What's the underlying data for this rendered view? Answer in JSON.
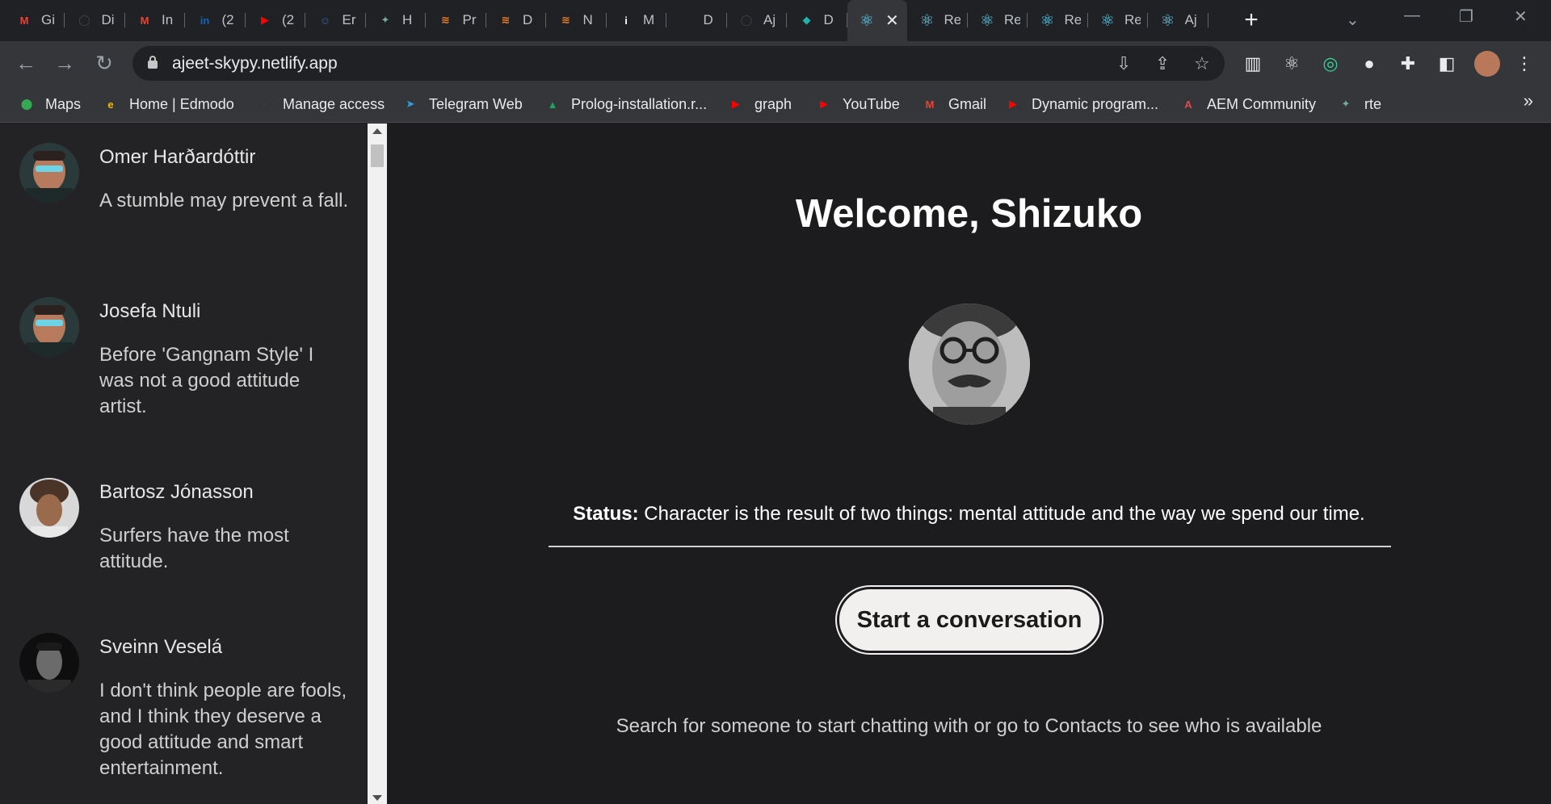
{
  "browser": {
    "tabs": [
      {
        "title": "Gi",
        "icon": "gmail-icon",
        "color": "#ea4335",
        "glyph": "M"
      },
      {
        "title": "Di",
        "icon": "github-icon",
        "color": "#444",
        "glyph": "◯"
      },
      {
        "title": "In",
        "icon": "gmail-icon",
        "color": "#ea4335",
        "glyph": "M"
      },
      {
        "title": "(2",
        "icon": "linkedin-icon",
        "color": "#0a66c2",
        "glyph": "in"
      },
      {
        "title": "(2",
        "icon": "youtube-icon",
        "color": "#ff0000",
        "glyph": "▶"
      },
      {
        "title": "Er",
        "icon": "person-icon",
        "color": "#2a6db5",
        "glyph": "☺"
      },
      {
        "title": "H",
        "icon": "chatgpt-icon",
        "color": "#74aa9c",
        "glyph": "✦"
      },
      {
        "title": "Pr",
        "icon": "stack-icon",
        "color": "#f48024",
        "glyph": "≋"
      },
      {
        "title": "D",
        "icon": "stack-icon",
        "color": "#f48024",
        "glyph": "≋"
      },
      {
        "title": "N",
        "icon": "stack-icon",
        "color": "#f48024",
        "glyph": "≋"
      },
      {
        "title": "M",
        "icon": "info-icon",
        "color": "#ffffff",
        "glyph": "i"
      },
      {
        "title": "D",
        "icon": "download-icon",
        "color": "#202124",
        "glyph": "⬇"
      },
      {
        "title": "Aj",
        "icon": "github-icon",
        "color": "#444",
        "glyph": "◯"
      },
      {
        "title": "D",
        "icon": "diamond-icon",
        "color": "#20b2aa",
        "glyph": "◆"
      }
    ],
    "active_tab": {
      "icon": "react-icon",
      "close": "✕"
    },
    "trailing_tabs": [
      {
        "title": "Re",
        "icon": "react-icon"
      },
      {
        "title": "Re",
        "icon": "react-icon"
      },
      {
        "title": "Re",
        "icon": "react-icon"
      },
      {
        "title": "Re",
        "icon": "react-icon"
      },
      {
        "title": "Aj",
        "icon": "react-icon"
      }
    ],
    "url": "ajeet-skypy.netlify.app",
    "bookmarks": [
      {
        "label": "Maps",
        "icon": "maps-icon",
        "color": "#34a853",
        "glyph": "⬤"
      },
      {
        "label": "Home | Edmodo",
        "icon": "edmodo-icon",
        "color": "#f5b800",
        "glyph": "e"
      },
      {
        "label": "Manage access",
        "icon": "github-icon",
        "color": "#333",
        "glyph": "◯"
      },
      {
        "label": "Telegram Web",
        "icon": "telegram-icon",
        "color": "#2aa3e0",
        "glyph": "➤"
      },
      {
        "label": "Prolog-installation.r...",
        "icon": "drive-icon",
        "color": "#1fa463",
        "glyph": "▲"
      },
      {
        "label": "graph",
        "icon": "youtube-icon",
        "color": "#ff0000",
        "glyph": "▶"
      },
      {
        "label": "YouTube",
        "icon": "youtube-icon",
        "color": "#ff0000",
        "glyph": "▶"
      },
      {
        "label": "Gmail",
        "icon": "gmail-icon",
        "color": "#ea4335",
        "glyph": "M"
      },
      {
        "label": "Dynamic program...",
        "icon": "youtube-icon",
        "color": "#ff0000",
        "glyph": "▶"
      },
      {
        "label": "AEM Community",
        "icon": "adobe-icon",
        "color": "#e34850",
        "glyph": "A"
      },
      {
        "label": "rte",
        "icon": "chatgpt-icon",
        "color": "#74aa9c",
        "glyph": "✦"
      }
    ],
    "more": "»"
  },
  "contacts": [
    {
      "name": "Omer Harðardóttir",
      "message": "A stumble may prevent a fall."
    },
    {
      "name": "Josefa Ntuli",
      "message": "Before 'Gangnam Style' I was not a good attitude artist."
    },
    {
      "name": "Bartosz Jónasson",
      "message": "Surfers have the most attitude."
    },
    {
      "name": "Sveinn Veselá",
      "message": "I don't think people are fools, and I think they deserve a good attitude and smart entertainment."
    }
  ],
  "main": {
    "welcome": "Welcome, Shizuko",
    "status_label": "Status:",
    "status_text": " Character is the result of two things: mental attitude and the way we spend our time.",
    "start_button": "Start a conversation",
    "hint": "Search for someone to start chatting with or go to Contacts to see who is available"
  }
}
